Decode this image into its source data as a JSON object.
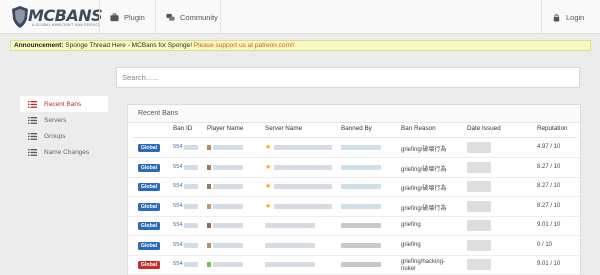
{
  "brand": {
    "logo_text": "MCBANS",
    "logo_tagline": "A GLOBAL MINECRAFT BAN SERVICE"
  },
  "nav": {
    "plugin_label": "Plugin",
    "community_label": "Community",
    "login_label": "Login"
  },
  "announcement": {
    "prefix": "Announcement:",
    "text": "Sponge Thread Here - MCBans for Sponge!",
    "support_text": "Please support us at patreon.com!!"
  },
  "search": {
    "placeholder": "Search......"
  },
  "sidebar": {
    "items": [
      {
        "label": "Recent Bans",
        "active": true
      },
      {
        "label": "Servers",
        "active": false
      },
      {
        "label": "Groups",
        "active": false
      },
      {
        "label": "Name Changes",
        "active": false
      }
    ]
  },
  "recent_bans": {
    "title": "Recent Bans",
    "columns": {
      "ban_id": "Ban ID",
      "player_name": "Player Name",
      "server_name": "Server Name",
      "banned_by": "Banned By",
      "ban_reason": "Ban Reason",
      "date_issued": "Date Issued",
      "reputation": "Reputation"
    },
    "rows": [
      {
        "type": "Global",
        "type_color": "#2a6ab6",
        "ban_id": "554",
        "reason": "griefing/破壊行為",
        "reputation": "4.97 / 10",
        "starred": true
      },
      {
        "type": "Global",
        "type_color": "#2a6ab6",
        "ban_id": "554",
        "reason": "griefing/破壊行為",
        "reputation": "8.27 / 10",
        "starred": true
      },
      {
        "type": "Global",
        "type_color": "#2a6ab6",
        "ban_id": "554",
        "reason": "griefing/破壊行為",
        "reputation": "8.27 / 10",
        "starred": true
      },
      {
        "type": "Global",
        "type_color": "#2a6ab6",
        "ban_id": "554",
        "reason": "griefing/破壊行為",
        "reputation": "8.27 / 10",
        "starred": true
      },
      {
        "type": "Global",
        "type_color": "#2a6ab6",
        "ban_id": "554",
        "reason": "griefing",
        "reputation": "9.01 / 10",
        "starred": false
      },
      {
        "type": "Global",
        "type_color": "#2a6ab6",
        "ban_id": "554",
        "reason": "griefing",
        "reputation": "0 / 10",
        "starred": false
      },
      {
        "type": "Global",
        "type_color": "#c62e2e",
        "ban_id": "554",
        "reason": "griefing/hacking-nuker",
        "reputation": "9.01 / 10",
        "starred": false
      }
    ]
  }
}
